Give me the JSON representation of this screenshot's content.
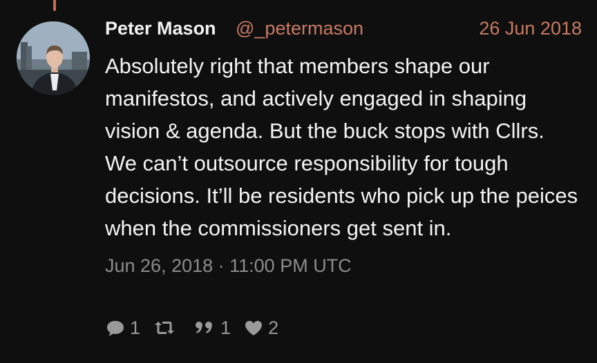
{
  "tweet": {
    "author_name": "Peter Mason",
    "author_handle": "@_petermason",
    "date": "26 Jun 2018",
    "text": "Absolutely right that members shape our manifestos, and actively engaged in shaping vision & agenda. But the buck stops with Cllrs. We can’t outsource responsibility for tough decisions. It’ll be residents who pick up the peices when the commissioners get sent in.",
    "timestamp": "Jun 26, 2018 · 11:00 PM UTC"
  },
  "actions": {
    "replies": "1",
    "retweets": "",
    "quotes": "1",
    "likes": "2"
  },
  "icons": {
    "reply": "comment-icon",
    "retweet": "retweet-icon",
    "quote": "quote-icon",
    "like": "heart-icon"
  },
  "colors": {
    "background": "#0f0f0f",
    "accent": "#c87a63",
    "text": "#f2f2f2",
    "muted": "#8c8c8c"
  }
}
